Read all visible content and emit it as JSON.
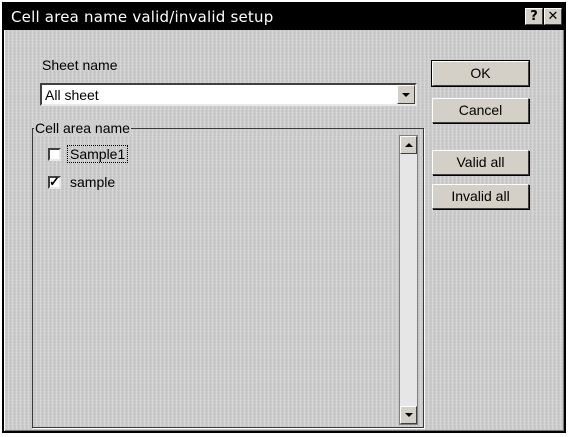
{
  "window": {
    "title": "Cell area name valid/invalid setup",
    "help_glyph": "?",
    "close_glyph": "✕"
  },
  "sheet": {
    "label": "Sheet name",
    "selected": "All sheet"
  },
  "cell_area": {
    "group_label": "Cell area name",
    "items": [
      {
        "label": "Sample1",
        "checked": false
      },
      {
        "label": "sample",
        "checked": true
      }
    ],
    "check_glyph": "✓"
  },
  "buttons": {
    "ok": "OK",
    "cancel": "Cancel",
    "valid_all": "Valid all",
    "invalid_all": "Invalid all"
  }
}
